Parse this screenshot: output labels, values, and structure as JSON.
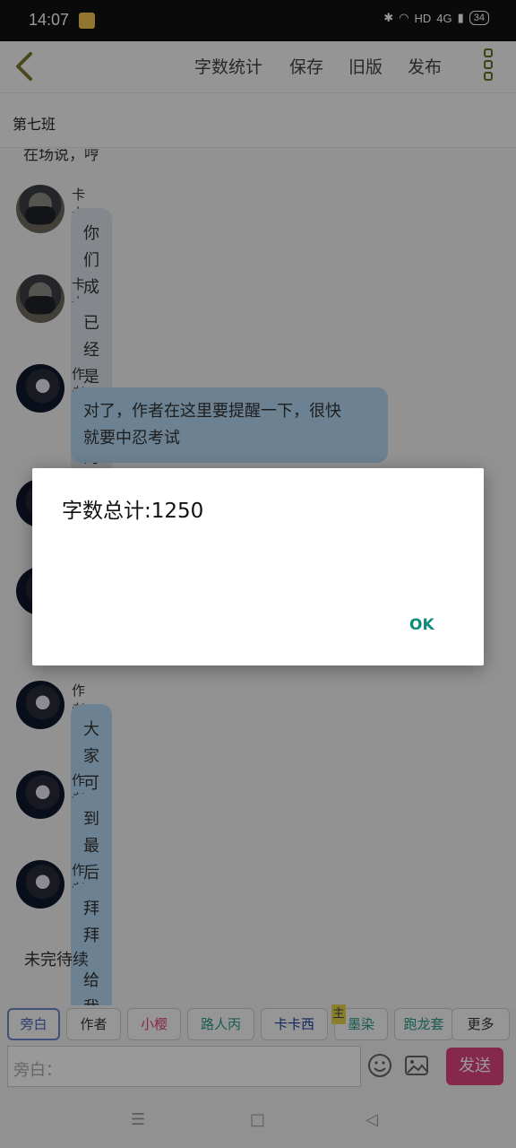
{
  "status": {
    "time": "14:07",
    "network": "HD",
    "signal": "4G",
    "battery": "34"
  },
  "toolbar": {
    "stats": "字数统计",
    "save": "保存",
    "old": "旧版",
    "publish": "发布"
  },
  "chat_title": "第七班",
  "cut_line": "在场说，哼",
  "messages": [
    {
      "author": "卡卡西",
      "text": "你们成功通关了"
    },
    {
      "author": "卡卡西",
      "text": "已经是合格的队伍了"
    },
    {
      "author": "作者",
      "line1": "对了，作者在这里要提醒一下，很快",
      "line2": "就要中忍考试"
    },
    {
      "author": "作者",
      "text": "大家可以在评论区里决定"
    },
    {
      "author": "作者",
      "text": "到最后要记得给我点个收藏"
    },
    {
      "author": "作者",
      "text": "拜拜"
    }
  ],
  "end_text": "未完待续",
  "roles": [
    "旁白",
    "作者",
    "小樱",
    "路人丙",
    "卡卡西",
    "墨染",
    "跑龙套",
    "更多"
  ],
  "role_badge": "主",
  "input": {
    "placeholder": "旁白："
  },
  "send_label": "发送",
  "dialog": {
    "message": "字数总计:1250",
    "ok": "OK"
  }
}
